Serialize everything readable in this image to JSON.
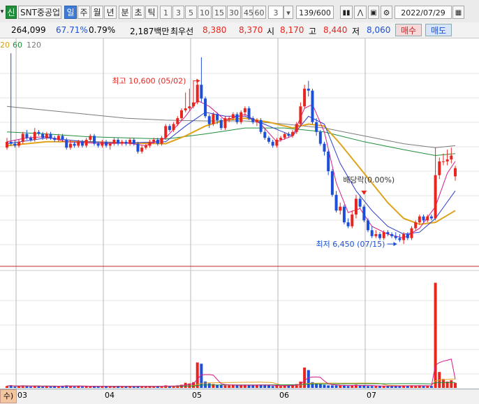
{
  "toolbar": {
    "badge": "신",
    "stock_name": "SNT중공업",
    "period_tabs": [
      "일",
      "주",
      "월",
      "년",
      "분",
      "초",
      "틱"
    ],
    "active_period": "일",
    "minute_buttons": [
      "1",
      "3",
      "5",
      "10",
      "15",
      "30",
      "45",
      "60"
    ],
    "minute_value": "3",
    "count_value": "139",
    "count_total": "/600",
    "date": "2022/07/29"
  },
  "info": {
    "volume": "264,099",
    "pct1": "67.71%",
    "pct2": "0.79%",
    "amount": "2,187백만",
    "priority_label": "최우선",
    "priority_ask": "8,380",
    "priority_bid": "8,370",
    "open_label": "시",
    "open": "8,170",
    "high_label": "고",
    "high": "8,440",
    "low_label": "저",
    "low": "8,060",
    "buy_label": "매수",
    "sell_label": "매도"
  },
  "legend": {
    "ma_labels": [
      "20",
      "60",
      "120"
    ],
    "colors": [
      "#d4a017",
      "#1f8f3a",
      "#7a7a7a"
    ]
  },
  "annotations": {
    "high_text": "최고 10,600 (05/02)",
    "low_text": "최저 6,450 (07/15)",
    "dividend_text": "배당락(0.00%)"
  },
  "axis": {
    "months": [
      "03",
      "04",
      "05",
      "06",
      "07"
    ],
    "left_label": "수)"
  },
  "colors": {
    "up": "#e8251f",
    "down": "#1d4fd8",
    "ma5": "#d81b8a",
    "ma10": "#2a3bd0",
    "ma20": "#e0a21a",
    "ma60": "#1f8f3a",
    "ma120": "#7a7a7a",
    "divider": "#c0282d"
  },
  "chart_data": {
    "type": "candlestick",
    "ylim": [
      5900,
      11500
    ],
    "x_range": [
      0,
      113
    ],
    "month_positions": [
      3,
      25,
      47,
      69,
      91
    ],
    "candles": [
      [
        0,
        8900,
        9050,
        9150,
        8850
      ],
      [
        1,
        9050,
        9000,
        11300,
        8950
      ],
      [
        2,
        9000,
        8950,
        9100,
        8900
      ],
      [
        3,
        8950,
        9050,
        9100,
        8900
      ],
      [
        4,
        9050,
        9250,
        9300,
        9000
      ],
      [
        5,
        9250,
        9150,
        9350,
        9100
      ],
      [
        6,
        9150,
        9100,
        9200,
        9050
      ],
      [
        7,
        9100,
        9300,
        9400,
        9050
      ],
      [
        8,
        9300,
        9250,
        9350,
        9200
      ],
      [
        9,
        9250,
        9150,
        9300,
        9100
      ],
      [
        10,
        9150,
        9250,
        9300,
        9100
      ],
      [
        11,
        9250,
        9150,
        9300,
        9100
      ],
      [
        12,
        9150,
        9100,
        9200,
        9050
      ],
      [
        13,
        9100,
        9200,
        9250,
        9050
      ],
      [
        14,
        9200,
        9100,
        9250,
        9050
      ],
      [
        15,
        9100,
        8900,
        9150,
        8850
      ],
      [
        16,
        8900,
        9000,
        9100,
        8850
      ],
      [
        17,
        9000,
        8950,
        9050,
        8900
      ],
      [
        18,
        8950,
        9050,
        9100,
        8900
      ],
      [
        19,
        9050,
        8950,
        9100,
        8900
      ],
      [
        20,
        8950,
        9100,
        9150,
        8900
      ],
      [
        21,
        9100,
        9200,
        9250,
        9050
      ],
      [
        22,
        9200,
        9000,
        9250,
        8950
      ],
      [
        23,
        9000,
        8950,
        9050,
        8900
      ],
      [
        24,
        8950,
        9050,
        9100,
        8900
      ],
      [
        25,
        9050,
        8950,
        9100,
        8900
      ],
      [
        26,
        8950,
        9000,
        9050,
        8850
      ],
      [
        27,
        9000,
        9100,
        9150,
        8950
      ],
      [
        28,
        9100,
        9000,
        9150,
        8950
      ],
      [
        29,
        9000,
        9050,
        9100,
        8950
      ],
      [
        30,
        9050,
        9000,
        9100,
        8950
      ],
      [
        31,
        9000,
        9100,
        9150,
        8950
      ],
      [
        32,
        9100,
        9000,
        9150,
        8950
      ],
      [
        33,
        9000,
        8800,
        9050,
        8750
      ],
      [
        34,
        8800,
        8900,
        8950,
        8750
      ],
      [
        35,
        8900,
        8950,
        9000,
        8850
      ],
      [
        36,
        8950,
        9050,
        9100,
        8900
      ],
      [
        37,
        9050,
        9100,
        9150,
        9000
      ],
      [
        38,
        9100,
        9000,
        9150,
        8950
      ],
      [
        39,
        9000,
        9150,
        9200,
        8950
      ],
      [
        40,
        9150,
        9450,
        9500,
        9100
      ],
      [
        41,
        9450,
        9350,
        9500,
        9300
      ],
      [
        42,
        9350,
        9500,
        9550,
        9300
      ],
      [
        43,
        9500,
        9650,
        9700,
        9450
      ],
      [
        44,
        9650,
        9850,
        9900,
        9600
      ],
      [
        45,
        9850,
        9900,
        10300,
        9800
      ],
      [
        46,
        9900,
        9950,
        10400,
        9850
      ],
      [
        47,
        9950,
        10050,
        10600,
        9900
      ],
      [
        48,
        10050,
        10500,
        10600,
        10000
      ],
      [
        49,
        10500,
        10150,
        11200,
        10050
      ],
      [
        50,
        10150,
        9700,
        10200,
        9650
      ],
      [
        51,
        9700,
        9500,
        9750,
        9400
      ],
      [
        52,
        9500,
        9750,
        9800,
        9450
      ],
      [
        53,
        9750,
        9600,
        9800,
        9500
      ],
      [
        54,
        9600,
        9400,
        9650,
        9350
      ],
      [
        55,
        9400,
        9650,
        9700,
        9350
      ],
      [
        56,
        9650,
        9650,
        9700,
        9550
      ],
      [
        57,
        9650,
        9750,
        9800,
        9600
      ],
      [
        58,
        9750,
        9550,
        9800,
        9500
      ],
      [
        59,
        9550,
        9800,
        9850,
        9500
      ],
      [
        60,
        9800,
        9900,
        9950,
        9700
      ],
      [
        61,
        9900,
        9650,
        9950,
        9600
      ],
      [
        62,
        9650,
        9550,
        9700,
        9500
      ],
      [
        63,
        9550,
        9600,
        9650,
        9450
      ],
      [
        64,
        9600,
        9300,
        9650,
        9250
      ],
      [
        65,
        9300,
        9150,
        9400,
        9100
      ],
      [
        66,
        9150,
        9050,
        9200,
        9000
      ],
      [
        67,
        9050,
        8950,
        9100,
        8900
      ],
      [
        68,
        8950,
        9100,
        9150,
        8900
      ],
      [
        69,
        9100,
        9150,
        9200,
        9050
      ],
      [
        70,
        9150,
        9250,
        9300,
        9100
      ],
      [
        71,
        9250,
        9200,
        9300,
        9150
      ],
      [
        72,
        9200,
        9300,
        9350,
        9150
      ],
      [
        73,
        9300,
        9500,
        9550,
        9250
      ],
      [
        74,
        9500,
        9950,
        10050,
        9450
      ],
      [
        75,
        9950,
        10400,
        10500,
        9900
      ],
      [
        76,
        10400,
        10350,
        10600,
        10200
      ],
      [
        77,
        10350,
        9550,
        10400,
        9500
      ],
      [
        78,
        9550,
        9300,
        9650,
        9200
      ],
      [
        79,
        9300,
        9000,
        9350,
        8950
      ],
      [
        80,
        9000,
        8800,
        9050,
        8700
      ],
      [
        81,
        8800,
        8300,
        8850,
        8200
      ],
      [
        82,
        8300,
        7700,
        8350,
        7650
      ],
      [
        83,
        7700,
        7300,
        7800,
        7250
      ],
      [
        84,
        7300,
        7400,
        7500,
        7200
      ],
      [
        85,
        7400,
        7000,
        7450,
        6950
      ],
      [
        86,
        7000,
        6900,
        7100,
        6850
      ],
      [
        87,
        6900,
        7200,
        7300,
        6850
      ],
      [
        88,
        7200,
        7600,
        7700,
        7100
      ],
      [
        89,
        7600,
        7400,
        7700,
        7350
      ],
      [
        90,
        7400,
        7050,
        7450,
        7000
      ],
      [
        91,
        7050,
        6800,
        7100,
        6750
      ],
      [
        92,
        6800,
        6650,
        6900,
        6600
      ],
      [
        93,
        6650,
        6700,
        6800,
        6600
      ],
      [
        94,
        6700,
        6600,
        6750,
        6550
      ],
      [
        95,
        6600,
        6750,
        6800,
        6550
      ],
      [
        96,
        6750,
        6700,
        6800,
        6650
      ],
      [
        97,
        6700,
        6650,
        6750,
        6600
      ],
      [
        98,
        6650,
        6600,
        6750,
        6550
      ],
      [
        99,
        6600,
        6550,
        6700,
        6500
      ],
      [
        100,
        6550,
        6700,
        6750,
        6450
      ],
      [
        101,
        6700,
        6600,
        6750,
        6550
      ],
      [
        102,
        6600,
        6850,
        6900,
        6550
      ],
      [
        103,
        6850,
        7000,
        7050,
        6800
      ],
      [
        104,
        7000,
        7150,
        7200,
        6950
      ],
      [
        105,
        7150,
        7050,
        7200,
        7000
      ],
      [
        106,
        7050,
        7150,
        7200,
        7000
      ],
      [
        107,
        7150,
        7100,
        7200,
        7050
      ],
      [
        108,
        7100,
        8200,
        8900,
        7050
      ],
      [
        109,
        8200,
        8550,
        8650,
        8100
      ],
      [
        110,
        8550,
        8550,
        8750,
        8450
      ],
      [
        111,
        8550,
        8600,
        8850,
        8450
      ],
      [
        112,
        8600,
        8700,
        8900,
        8500
      ],
      [
        113,
        8170,
        8380,
        8440,
        8060
      ]
    ],
    "ma5": [
      [
        0,
        9050
      ],
      [
        5,
        9150
      ],
      [
        10,
        9180
      ],
      [
        15,
        9050
      ],
      [
        20,
        9020
      ],
      [
        25,
        9000
      ],
      [
        30,
        9020
      ],
      [
        35,
        8950
      ],
      [
        40,
        9150
      ],
      [
        45,
        9700
      ],
      [
        48,
        10100
      ],
      [
        51,
        9950
      ],
      [
        55,
        9600
      ],
      [
        60,
        9750
      ],
      [
        64,
        9500
      ],
      [
        68,
        9050
      ],
      [
        72,
        9200
      ],
      [
        75,
        9900
      ],
      [
        77,
        10000
      ],
      [
        80,
        9300
      ],
      [
        83,
        8000
      ],
      [
        86,
        7250
      ],
      [
        89,
        7350
      ],
      [
        92,
        6900
      ],
      [
        96,
        6700
      ],
      [
        100,
        6600
      ],
      [
        104,
        6850
      ],
      [
        108,
        7400
      ],
      [
        111,
        8250
      ],
      [
        113,
        8550
      ]
    ],
    "ma10": [
      [
        0,
        9000
      ],
      [
        10,
        9150
      ],
      [
        20,
        9050
      ],
      [
        30,
        9020
      ],
      [
        40,
        9050
      ],
      [
        45,
        9450
      ],
      [
        50,
        9800
      ],
      [
        55,
        9700
      ],
      [
        60,
        9700
      ],
      [
        66,
        9450
      ],
      [
        72,
        9200
      ],
      [
        76,
        9700
      ],
      [
        80,
        9500
      ],
      [
        84,
        8500
      ],
      [
        88,
        7800
      ],
      [
        92,
        7300
      ],
      [
        96,
        6900
      ],
      [
        100,
        6700
      ],
      [
        104,
        6750
      ],
      [
        108,
        7100
      ],
      [
        113,
        7800
      ]
    ],
    "ma20": [
      [
        0,
        8950
      ],
      [
        10,
        9050
      ],
      [
        20,
        9050
      ],
      [
        30,
        9020
      ],
      [
        40,
        9000
      ],
      [
        45,
        9200
      ],
      [
        50,
        9450
      ],
      [
        55,
        9600
      ],
      [
        60,
        9650
      ],
      [
        66,
        9550
      ],
      [
        72,
        9400
      ],
      [
        76,
        9500
      ],
      [
        80,
        9450
      ],
      [
        84,
        9000
      ],
      [
        88,
        8500
      ],
      [
        92,
        8000
      ],
      [
        96,
        7500
      ],
      [
        100,
        7100
      ],
      [
        104,
        6950
      ],
      [
        108,
        7000
      ],
      [
        113,
        7300
      ]
    ],
    "ma60": [
      [
        0,
        9300
      ],
      [
        10,
        9250
      ],
      [
        20,
        9180
      ],
      [
        30,
        9150
      ],
      [
        40,
        9120
      ],
      [
        50,
        9250
      ],
      [
        60,
        9400
      ],
      [
        70,
        9400
      ],
      [
        80,
        9300
      ],
      [
        90,
        9050
      ],
      [
        100,
        8850
      ],
      [
        108,
        8700
      ],
      [
        113,
        8750
      ]
    ],
    "ma120": [
      [
        0,
        9950
      ],
      [
        10,
        9850
      ],
      [
        20,
        9750
      ],
      [
        30,
        9650
      ],
      [
        40,
        9600
      ],
      [
        50,
        9580
      ],
      [
        60,
        9580
      ],
      [
        70,
        9500
      ],
      [
        80,
        9400
      ],
      [
        90,
        9200
      ],
      [
        100,
        9000
      ],
      [
        108,
        8900
      ],
      [
        113,
        8950
      ]
    ],
    "volume": [
      3,
      4,
      2,
      3,
      4,
      3,
      2,
      3,
      3,
      2,
      3,
      2,
      3,
      2,
      3,
      4,
      3,
      2,
      3,
      2,
      3,
      2,
      3,
      2,
      2,
      3,
      2,
      2,
      3,
      2,
      2,
      3,
      2,
      3,
      2,
      2,
      3,
      2,
      3,
      2,
      4,
      3,
      3,
      4,
      5,
      8,
      7,
      9,
      40,
      38,
      10,
      7,
      6,
      5,
      5,
      4,
      4,
      5,
      4,
      4,
      5,
      4,
      4,
      5,
      5,
      4,
      4,
      3,
      4,
      3,
      4,
      4,
      5,
      6,
      10,
      32,
      28,
      9,
      7,
      6,
      5,
      4,
      4,
      4,
      4,
      4,
      3,
      4,
      5,
      4,
      4,
      3,
      3,
      3,
      3,
      3,
      3,
      3,
      3,
      3,
      4,
      3,
      4,
      3,
      4,
      3,
      3,
      3,
      165,
      25,
      14,
      10,
      12,
      8
    ],
    "volume_ylim": [
      0,
      170
    ],
    "high_marker": {
      "x": 49,
      "value": 10600
    },
    "low_marker": {
      "x": 99,
      "value": 6450
    },
    "dividend_marker": {
      "x": 90,
      "value": 7700
    }
  }
}
